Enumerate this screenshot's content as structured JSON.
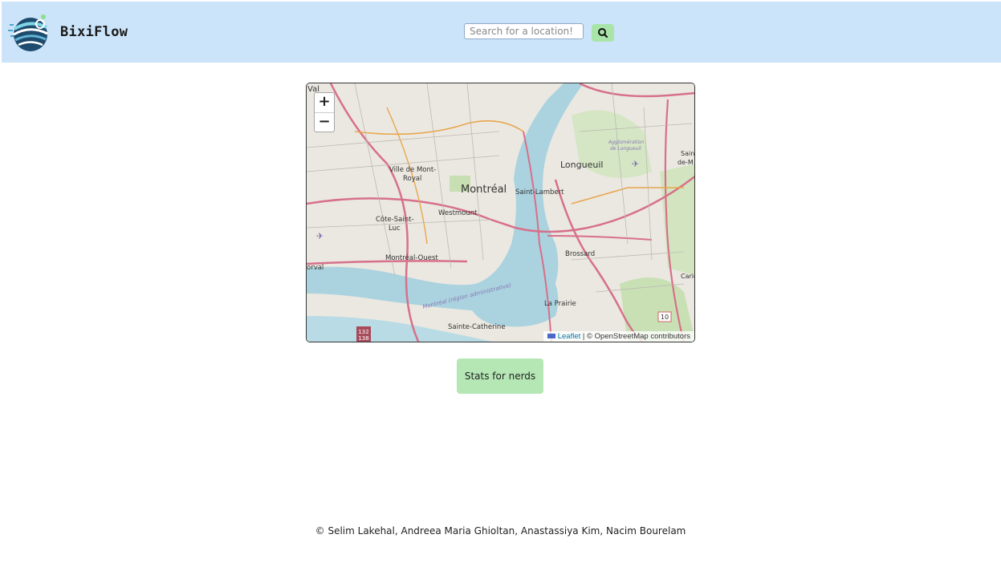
{
  "header": {
    "brand": "BixiFlow",
    "logo_icon": "bixiflow-logo-icon",
    "background": "#cce4f9"
  },
  "search": {
    "placeholder": "Search for a location!",
    "value": "",
    "button_icon": "search-icon",
    "button_color": "#a9e5a9"
  },
  "map": {
    "zoom_in": "+",
    "zoom_out": "−",
    "attribution_leaflet": "Leaflet",
    "attribution_rest": " | © OpenStreetMap contributors",
    "places": {
      "val": "Val",
      "ville_mont_royal_1": "Ville de Mont-",
      "ville_mont_royal_2": "Royal",
      "montreal": "Montréal",
      "westmount": "Westmount",
      "cote_saint_luc_1": "Côte-Saint-",
      "cote_saint_luc_2": "Luc",
      "montreal_ouest": "Montréal-Ouest",
      "dorval": "orval",
      "saint_lambert": "Saint-Lambert",
      "longueuil": "Longueuil",
      "agglo_1": "Agglomération",
      "agglo_2": "de Longueuil",
      "brossard": "Brossard",
      "la_prairie": "La Prairie",
      "sainte_catherine": "Sainte-Catherine",
      "carignan": "Carign",
      "saint_1": "Sain",
      "saint_2": "de-M",
      "region": "Montréal (région administrative)",
      "route_10": "10",
      "route_132": "132",
      "route_138": "138"
    }
  },
  "stats_button": "Stats for nerds",
  "footer": "© Selim Lakehal, Andreea Maria Ghioltan, Anastassiya Kim, Nacim Bourelam"
}
